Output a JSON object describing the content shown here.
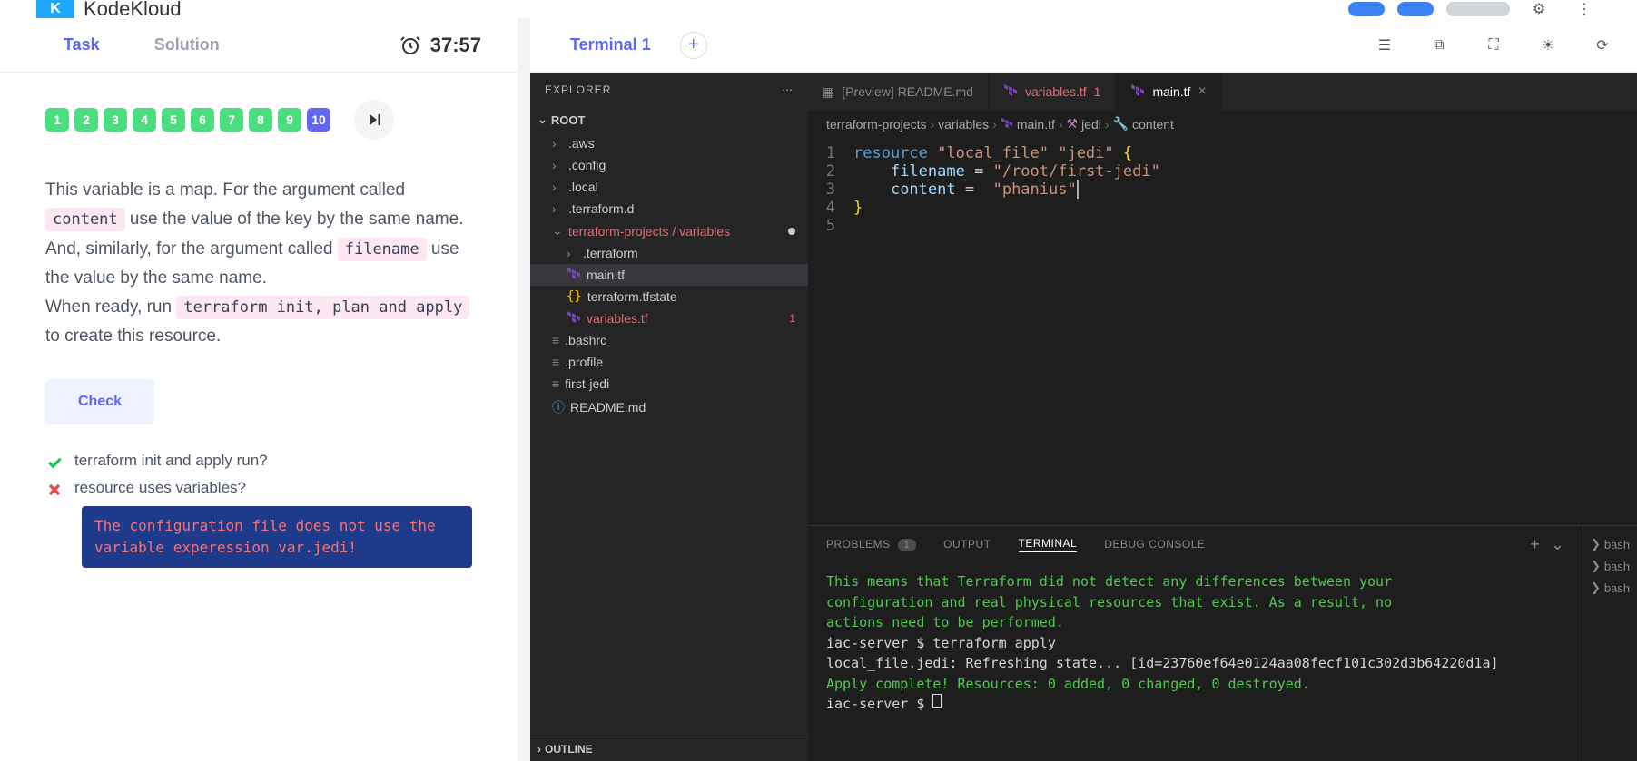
{
  "brand": "KodeKloud",
  "timer": "37:57",
  "left_tabs": {
    "task": "Task",
    "solution": "Solution"
  },
  "questions": [
    {
      "n": "1",
      "state": "done"
    },
    {
      "n": "2",
      "state": "done"
    },
    {
      "n": "3",
      "state": "done"
    },
    {
      "n": "4",
      "state": "done"
    },
    {
      "n": "5",
      "state": "done"
    },
    {
      "n": "6",
      "state": "done"
    },
    {
      "n": "7",
      "state": "done"
    },
    {
      "n": "8",
      "state": "done"
    },
    {
      "n": "9",
      "state": "done"
    },
    {
      "n": "10",
      "state": "current"
    }
  ],
  "task": {
    "line1_pre": "This variable is a map. For the argument called ",
    "code_content": "content",
    "line1_post": " use the value of the key by the same name.",
    "line2_pre": "And, similarly, for the argument called ",
    "code_filename": "filename",
    "line2_post": " use the value by the same name.",
    "line3_pre": "When ready, run ",
    "code_cmd": "terraform init, plan and apply",
    "line3_post": " to create this resource."
  },
  "check_label": "Check",
  "checks": [
    {
      "ok": true,
      "text": "terraform init and apply run?"
    },
    {
      "ok": false,
      "text": "resource uses variables?"
    }
  ],
  "error_msg": "The configuration file does not use the variable experession var.jedi!",
  "terminal_tab": "Terminal 1",
  "explorer": {
    "title": "EXPLORER",
    "root": "ROOT",
    "items": [
      {
        "name": ".aws",
        "kind": "folder",
        "depth": 0
      },
      {
        "name": ".config",
        "kind": "folder",
        "depth": 0
      },
      {
        "name": ".local",
        "kind": "folder",
        "depth": 0
      },
      {
        "name": ".terraform.d",
        "kind": "folder",
        "depth": 0
      }
    ],
    "open_folder": "terraform-projects / variables",
    "open_items": [
      {
        "name": ".terraform",
        "kind": "folder",
        "depth": 1
      },
      {
        "name": "main.tf",
        "kind": "tf",
        "depth": 1,
        "selected": true
      },
      {
        "name": "terraform.tfstate",
        "kind": "json",
        "depth": 1
      },
      {
        "name": "variables.tf",
        "kind": "tf",
        "depth": 1,
        "error": "1"
      }
    ],
    "rest": [
      {
        "name": ".bashrc",
        "kind": "file"
      },
      {
        "name": ".profile",
        "kind": "file"
      },
      {
        "name": "first-jedi",
        "kind": "file"
      },
      {
        "name": "README.md",
        "kind": "md"
      }
    ],
    "outline": "OUTLINE"
  },
  "editor_tabs": [
    {
      "label": "[Preview] README.md",
      "active": false,
      "icon": "md"
    },
    {
      "label": "variables.tf",
      "badge": "1",
      "active": false,
      "icon": "tf",
      "error": true
    },
    {
      "label": "main.tf",
      "active": true,
      "icon": "tf"
    }
  ],
  "breadcrumb": [
    "terraform-projects",
    "variables",
    "main.tf",
    "jedi",
    "content"
  ],
  "code": {
    "l1": {
      "kw": "resource",
      "s1": "\"local_file\"",
      "s2": "\"jedi\"",
      "brace": "{"
    },
    "l2": {
      "id": "filename",
      "eq": "=",
      "val": "\"/root/first-jedi\""
    },
    "l3": {
      "id": "content",
      "eq": "=",
      "val": "\"phanius\""
    },
    "l4": {
      "brace": "}"
    }
  },
  "bottom_tabs": {
    "problems": "PROBLEMS",
    "problems_badge": "1",
    "output": "OUTPUT",
    "terminal": "TERMINAL",
    "debug": "DEBUG CONSOLE"
  },
  "terminal_lines": [
    {
      "cls": "green",
      "text": "This means that Terraform did not detect any differences between your"
    },
    {
      "cls": "green",
      "text": "configuration and real physical resources that exist. As a result, no"
    },
    {
      "cls": "green",
      "text": "actions need to be performed."
    },
    {
      "cls": "white",
      "text": "iac-server $ terraform apply"
    },
    {
      "cls": "white",
      "text": "local_file.jedi: Refreshing state... [id=23760ef64e0124aa08fecf101c302d3b64220d1a]"
    },
    {
      "cls": "white",
      "text": ""
    },
    {
      "cls": "green",
      "text": "Apply complete! Resources: 0 added, 0 changed, 0 destroyed."
    }
  ],
  "terminal_prompt": "iac-server $ ",
  "side_shells": [
    "bash",
    "bash",
    "bash"
  ]
}
